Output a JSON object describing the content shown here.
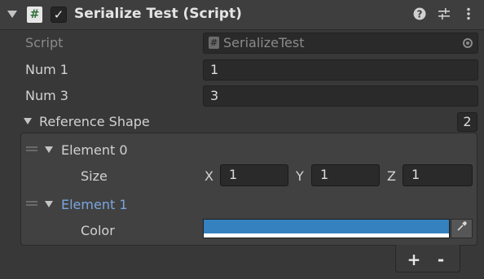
{
  "header": {
    "title": "Serialize Test (Script)",
    "script_icon": "#",
    "enabled_check": "✓",
    "icons": [
      "help-icon",
      "presets-icon",
      "more-menu-icon"
    ]
  },
  "fields": {
    "script_label": "Script",
    "script_value": "SerializeTest",
    "num1_label": "Num 1",
    "num1_value": "1",
    "num3_label": "Num 3",
    "num3_value": "3"
  },
  "list": {
    "label": "Reference Shape",
    "count": "2",
    "elements": [
      {
        "label": "Element 0",
        "prop_label": "Size",
        "x_label": "X",
        "x_value": "1",
        "y_label": "Y",
        "y_value": "1",
        "z_label": "Z",
        "z_value": "1"
      },
      {
        "label": "Element 1",
        "prop_label": "Color",
        "color_value": "#3581bf"
      }
    ],
    "add_label": "+",
    "remove_label": "-"
  },
  "colors": {
    "background": "#383838",
    "selected_text": "#7ba6e0",
    "color_swatch": "#3581bf"
  }
}
